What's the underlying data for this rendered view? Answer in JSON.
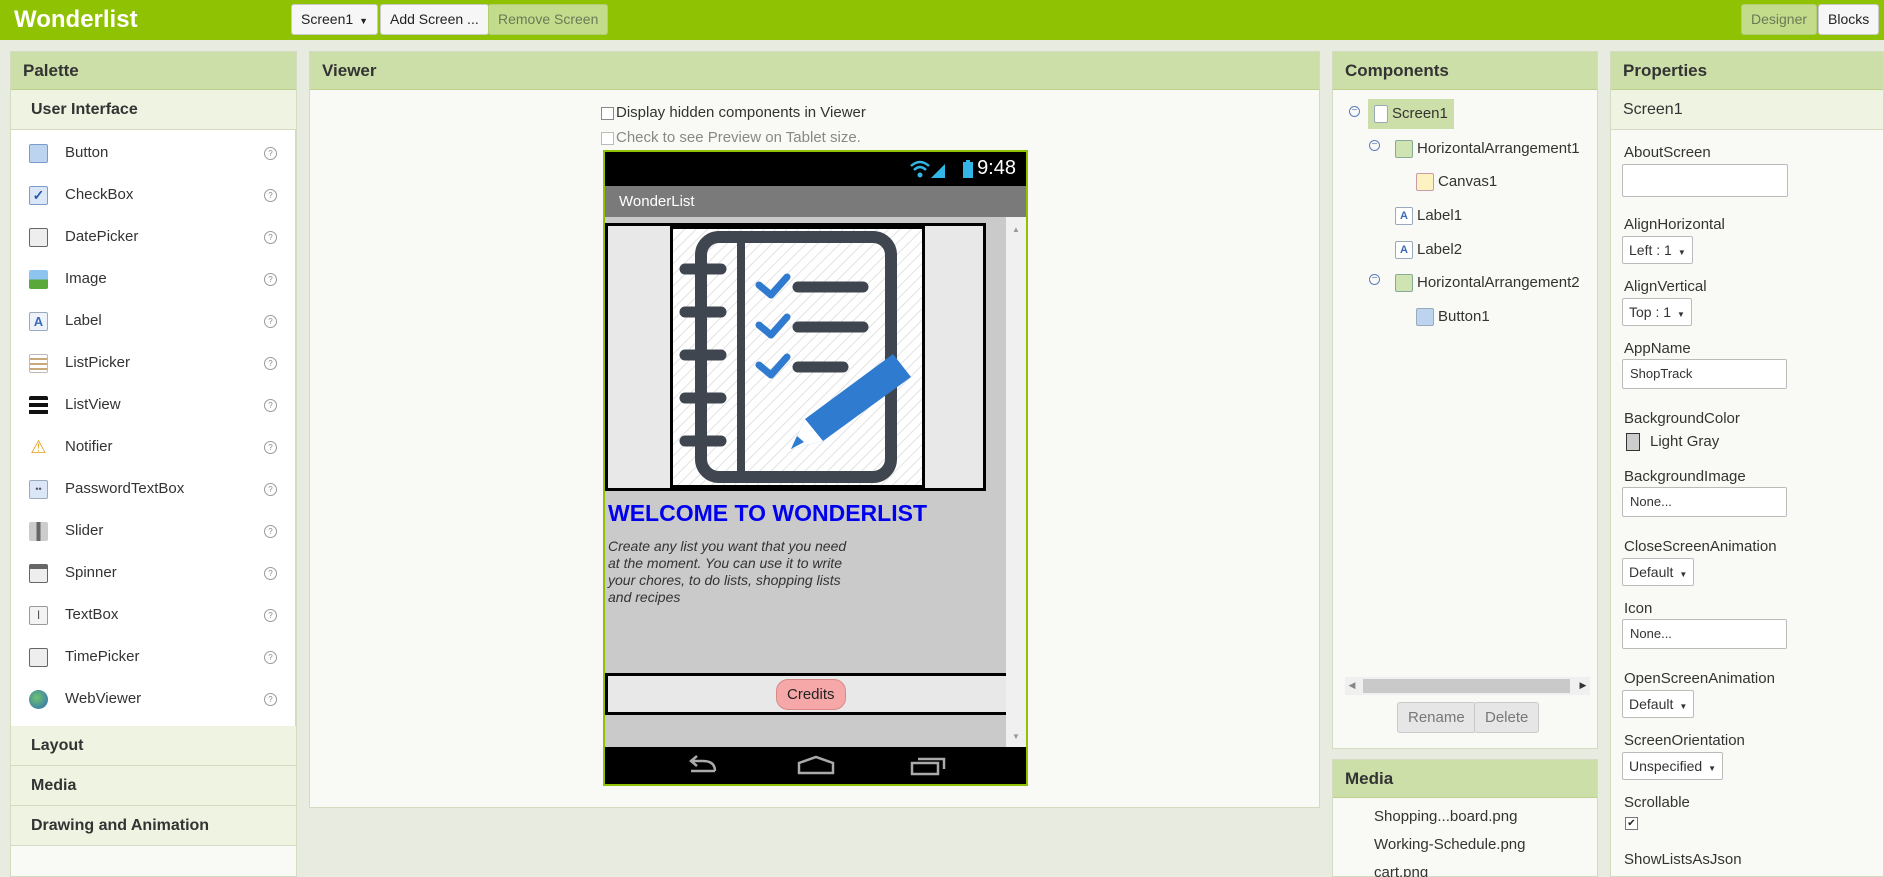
{
  "app": {
    "brand": "Wonderlist"
  },
  "toolbar": {
    "screen_select": "Screen1",
    "add_screen": "Add Screen ...",
    "remove_screen": "Remove Screen",
    "designer": "Designer",
    "blocks": "Blocks"
  },
  "palette": {
    "title": "Palette",
    "active_category": "User Interface",
    "items": [
      {
        "label": "Button",
        "icon": "button-icon"
      },
      {
        "label": "CheckBox",
        "icon": "checkbox-icon"
      },
      {
        "label": "DatePicker",
        "icon": "datepicker-icon"
      },
      {
        "label": "Image",
        "icon": "image-icon"
      },
      {
        "label": "Label",
        "icon": "label-icon"
      },
      {
        "label": "ListPicker",
        "icon": "listpicker-icon"
      },
      {
        "label": "ListView",
        "icon": "listview-icon"
      },
      {
        "label": "Notifier",
        "icon": "notifier-icon"
      },
      {
        "label": "PasswordTextBox",
        "icon": "password-icon"
      },
      {
        "label": "Slider",
        "icon": "slider-icon"
      },
      {
        "label": "Spinner",
        "icon": "spinner-icon"
      },
      {
        "label": "TextBox",
        "icon": "textbox-icon"
      },
      {
        "label": "TimePicker",
        "icon": "timepicker-icon"
      },
      {
        "label": "WebViewer",
        "icon": "webviewer-icon"
      }
    ],
    "help_glyph": "?",
    "other_categories": [
      "Layout",
      "Media",
      "Drawing and Animation"
    ]
  },
  "viewer": {
    "title": "Viewer",
    "hidden_components": "Display hidden components in Viewer",
    "tablet_preview": "Check to see Preview on Tablet size.",
    "phone": {
      "time": "9:48",
      "app_title": "WonderList",
      "welcome": "WELCOME TO WONDERLIST",
      "description": "Create any list you want that you need at the moment. You can use it to write your chores, to do lists, shopping lists and recipes",
      "credits_button": "Credits"
    }
  },
  "components": {
    "title": "Components",
    "tree": [
      {
        "label": "Screen1",
        "selected": true
      },
      {
        "label": "HorizontalArrangement1"
      },
      {
        "label": "Canvas1"
      },
      {
        "label": "Label1"
      },
      {
        "label": "Label2"
      },
      {
        "label": "HorizontalArrangement2"
      },
      {
        "label": "Button1"
      }
    ],
    "collapse_glyph": "−",
    "rename": "Rename",
    "delete": "Delete"
  },
  "media": {
    "title": "Media",
    "files": [
      "Shopping...board.png",
      "Working-Schedule.png",
      "cart.png"
    ]
  },
  "properties": {
    "title": "Properties",
    "component": "Screen1",
    "about_label": "AboutScreen",
    "about_value": "",
    "align_h_label": "AlignHorizontal",
    "align_h_value": "Left : 1",
    "align_v_label": "AlignVertical",
    "align_v_value": "Top : 1",
    "appname_label": "AppName",
    "appname_value": "ShopTrack",
    "bgcolor_label": "BackgroundColor",
    "bgcolor_value": "Light Gray",
    "bgcolor_swatch": "#cccccc",
    "bgimage_label": "BackgroundImage",
    "bgimage_value": "None...",
    "close_anim_label": "CloseScreenAnimation",
    "close_anim_value": "Default",
    "icon_label": "Icon",
    "icon_value": "None...",
    "open_anim_label": "OpenScreenAnimation",
    "open_anim_value": "Default",
    "orientation_label": "ScreenOrientation",
    "orientation_value": "Unspecified",
    "scrollable_label": "Scrollable",
    "scrollable_checked": true,
    "showlists_label": "ShowListsAsJson"
  },
  "colors": {
    "accent": "#8fc202",
    "header": "#cddfa8",
    "welcome": "#0000ee"
  }
}
